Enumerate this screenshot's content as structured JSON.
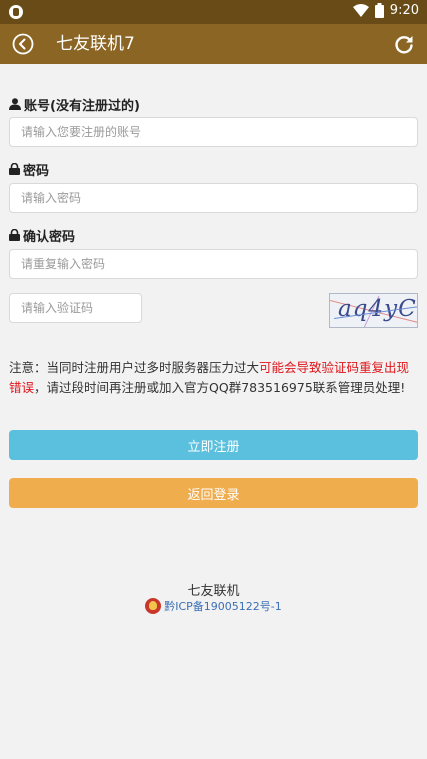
{
  "status_bar": {
    "time": "9:20"
  },
  "app_bar": {
    "title": "七友联机7"
  },
  "form": {
    "account_label": "账号(没有注册过的)",
    "account_placeholder": "请输入您要注册的账号",
    "password_label": "密码",
    "password_placeholder": "请输入密码",
    "confirm_label": "确认密码",
    "confirm_placeholder": "请重复输入密码",
    "captcha_placeholder": "请输入验证码",
    "captcha_text": "aq4yC"
  },
  "notice": {
    "part1": "注意：当同时注册用户过多时服务器压力过大",
    "part2_red": "可能会导致验证码重复出现错误",
    "part3": "，请过段时间再注册或加入官方QQ群783516975联系管理员处理!"
  },
  "buttons": {
    "register": "立即注册",
    "back_login": "返回登录"
  },
  "footer": {
    "name": "七友联机",
    "icp": "黔ICP备19005122号-1"
  },
  "colors": {
    "status_bar": "#684b16",
    "app_bar": "#8b6524",
    "register_button": "#5bc0de",
    "back_button": "#f0ad4e",
    "notice_red": "#e0151b",
    "icp_link": "#3b6fb6"
  }
}
